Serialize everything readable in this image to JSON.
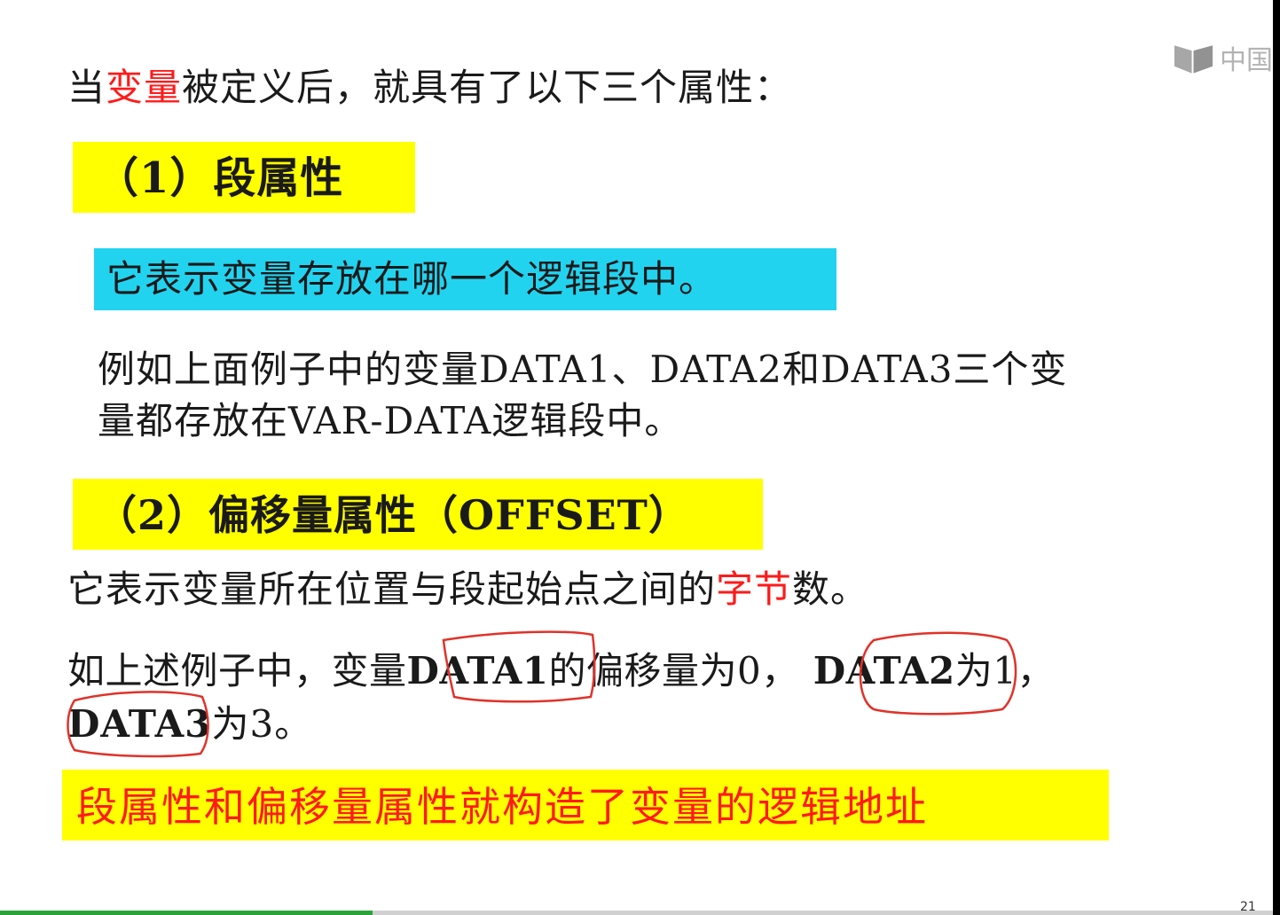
{
  "slide": {
    "intro": {
      "prefix": "当",
      "highlight": "变量",
      "suffix": "被定义后，就具有了以下三个属性："
    },
    "attr1": {
      "heading": "（1）段属性",
      "definition": "它表示变量存放在哪一个逻辑段中。",
      "example_line1": "例如上面例子中的变量DATA1、DATA2和DATA3三个变",
      "example_line2": "量都存放在VAR-DATA逻辑段中。"
    },
    "attr2": {
      "heading": "（2）偏移量属性（OFFSET）",
      "definition_prefix": "它表示变量所在位置与段起始点之间的",
      "definition_highlight": "字节",
      "definition_suffix": "数。",
      "example_seg1": "如上述例子中，变量",
      "example_seg2": "DATA1",
      "example_seg3": "的偏移量为0，",
      "example_seg4": "DATA2",
      "example_seg5": "为1，",
      "example_seg6": "DATA3",
      "example_seg7": "为3。"
    },
    "conclusion": "段属性和偏移量属性就构造了变量的逻辑地址",
    "logo_text": "中国",
    "page_number": "21"
  },
  "colors": {
    "highlight_red": "#ff1a1a",
    "yellow": "#ffff00",
    "cyan": "#22d3f0",
    "progress_green": "#2aa33a"
  },
  "annotations": {
    "ink_circles": [
      "DATA1",
      "DATA2",
      "DATA3"
    ]
  }
}
